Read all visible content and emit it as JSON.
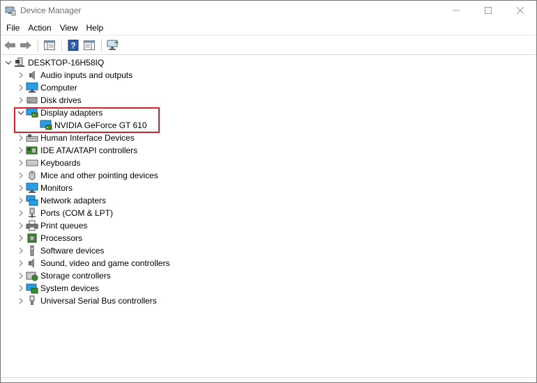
{
  "window": {
    "title": "Device Manager"
  },
  "menu": [
    "File",
    "Action",
    "View",
    "Help"
  ],
  "toolbar": {
    "buttons": [
      "back-icon",
      "forward-icon",
      "properties-pane-icon",
      "help-icon",
      "details-view-icon",
      "monitor-scan-icon"
    ]
  },
  "tree": {
    "root": "DESKTOP-16H58IQ",
    "categories": [
      {
        "label": "Audio inputs and outputs",
        "icon": "speaker-icon"
      },
      {
        "label": "Computer",
        "icon": "computer-icon"
      },
      {
        "label": "Disk drives",
        "icon": "disk-drive-icon"
      },
      {
        "label": "Display adapters",
        "icon": "display-adapter-icon",
        "expanded": true,
        "children": [
          {
            "label": "NVIDIA GeForce GT 610",
            "icon": "display-adapter-icon"
          }
        ]
      },
      {
        "label": "Human Interface Devices",
        "icon": "hid-icon"
      },
      {
        "label": "IDE ATA/ATAPI controllers",
        "icon": "ide-controller-icon"
      },
      {
        "label": "Keyboards",
        "icon": "keyboard-icon"
      },
      {
        "label": "Mice and other pointing devices",
        "icon": "mouse-icon"
      },
      {
        "label": "Monitors",
        "icon": "monitor-icon"
      },
      {
        "label": "Network adapters",
        "icon": "network-adapter-icon"
      },
      {
        "label": "Ports (COM & LPT)",
        "icon": "port-icon"
      },
      {
        "label": "Print queues",
        "icon": "printer-icon"
      },
      {
        "label": "Processors",
        "icon": "processor-icon"
      },
      {
        "label": "Software devices",
        "icon": "software-device-icon"
      },
      {
        "label": "Sound, video and game controllers",
        "icon": "sound-icon"
      },
      {
        "label": "Storage controllers",
        "icon": "storage-controller-icon"
      },
      {
        "label": "System devices",
        "icon": "system-device-icon"
      },
      {
        "label": "Universal Serial Bus controllers",
        "icon": "usb-icon"
      }
    ]
  },
  "colors": {
    "highlight": "#d4202a",
    "title_text": "#6d6d6d"
  }
}
